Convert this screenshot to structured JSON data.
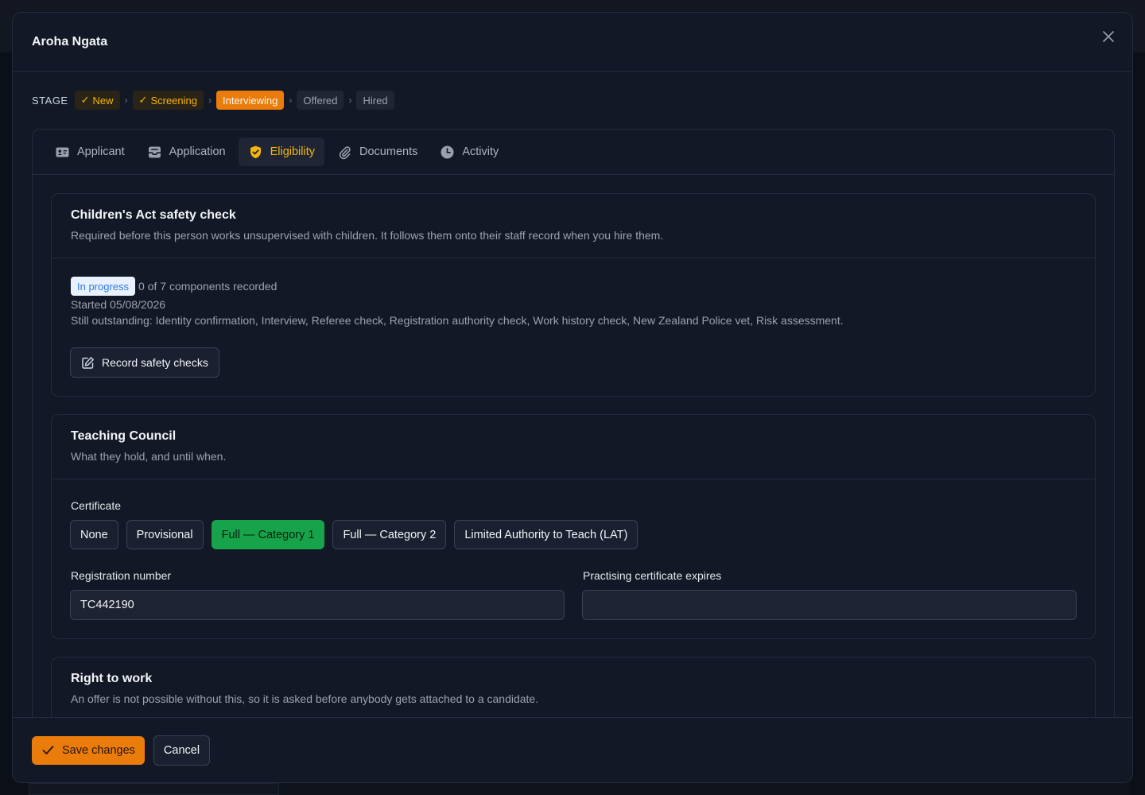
{
  "modal": {
    "title": "Aroha Ngata"
  },
  "stage": {
    "label": "STAGE",
    "steps": [
      {
        "label": "New",
        "state": "done"
      },
      {
        "label": "Screening",
        "state": "done"
      },
      {
        "label": "Interviewing",
        "state": "current"
      },
      {
        "label": "Offered",
        "state": "future"
      },
      {
        "label": "Hired",
        "state": "future"
      }
    ],
    "check_glyph": "✓",
    "separator_glyph": "›"
  },
  "tabs": [
    {
      "label": "Applicant",
      "icon": "id-card-icon",
      "active": false
    },
    {
      "label": "Application",
      "icon": "inbox-icon",
      "active": false
    },
    {
      "label": "Eligibility",
      "icon": "shield-check-icon",
      "active": true
    },
    {
      "label": "Documents",
      "icon": "paperclip-icon",
      "active": false
    },
    {
      "label": "Activity",
      "icon": "clock-icon",
      "active": false
    }
  ],
  "safety_check": {
    "title": "Children's Act safety check",
    "description": "Required before this person works unsupervised with children. It follows them onto their staff record when you hire them.",
    "status_badge": "In progress",
    "progress_text": "0 of 7 components recorded",
    "started_text": "Started 05/08/2026",
    "outstanding_text": "Still outstanding: Identity confirmation, Interview, Referee check, Registration authority check, Work history check, New Zealand Police vet, Risk assessment.",
    "record_button": "Record safety checks"
  },
  "teaching_council": {
    "title": "Teaching Council",
    "description": "What they hold, and until when.",
    "certificate_label": "Certificate",
    "certificate_options": [
      {
        "label": "None",
        "selected": false
      },
      {
        "label": "Provisional",
        "selected": false
      },
      {
        "label": "Full — Category 1",
        "selected": true
      },
      {
        "label": "Full — Category 2",
        "selected": false
      },
      {
        "label": "Limited Authority to Teach (LAT)",
        "selected": false
      }
    ],
    "registration_label": "Registration number",
    "registration_value": "TC442190",
    "expires_label": "Practising certificate expires",
    "expires_value": ""
  },
  "right_to_work": {
    "title": "Right to work",
    "description": "An offer is not possible without this, so it is asked before anybody gets attached to a candidate."
  },
  "footer": {
    "save_label": "Save changes",
    "cancel_label": "Cancel"
  },
  "colors": {
    "accent": "#ea7c0c",
    "done_text": "#f5b50b",
    "selected_green": "#16a34a",
    "badge_blue": "#2f7ae5"
  }
}
